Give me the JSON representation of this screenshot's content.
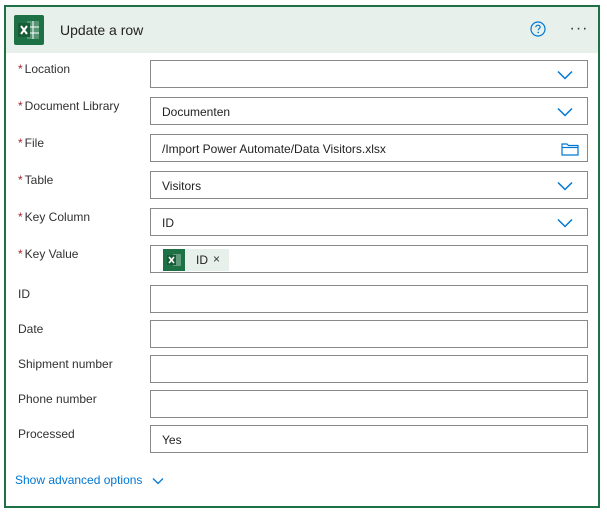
{
  "header": {
    "title": "Update a row",
    "app_icon": "excel-icon",
    "help_icon": "help-circle-icon",
    "more_label": "···"
  },
  "required_mark": "*",
  "fields": {
    "location": {
      "label": "Location",
      "value": ""
    },
    "document_library": {
      "label": "Document Library",
      "value": "Documenten"
    },
    "file": {
      "label": "File",
      "value": "/Import Power Automate/Data Visitors.xlsx"
    },
    "table": {
      "label": "Table",
      "value": "Visitors"
    },
    "key_column": {
      "label": "Key Column",
      "value": "ID"
    },
    "key_value": {
      "label": "Key Value",
      "token_label": "ID",
      "token_remove": "×"
    },
    "id": {
      "label": "ID",
      "value": ""
    },
    "date": {
      "label": "Date",
      "value": ""
    },
    "shipment_number": {
      "label": "Shipment number",
      "value": ""
    },
    "phone_number": {
      "label": "Phone number",
      "value": ""
    },
    "processed": {
      "label": "Processed",
      "value": "Yes"
    }
  },
  "footer": {
    "show_advanced_label": "Show advanced options"
  },
  "colors": {
    "brand": "#1e7145",
    "header_bg": "#e8f0ec",
    "required": "#a4262c",
    "link": "#0078d4"
  }
}
